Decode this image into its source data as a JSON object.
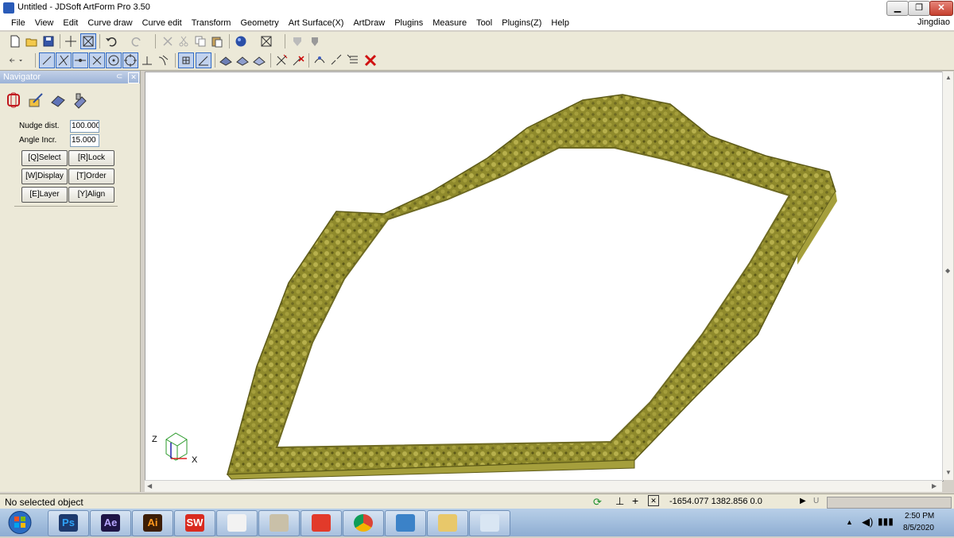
{
  "window": {
    "title": "Untitled - JDSoft ArtForm Pro 3.50",
    "user": "Jingdiao"
  },
  "menu": [
    "File",
    "View",
    "Edit",
    "Curve draw",
    "Curve edit",
    "Transform",
    "Geometry",
    "Art Surface(X)",
    "ArtDraw",
    "Plugins",
    "Measure",
    "Tool",
    "Plugins(Z)",
    "Help"
  ],
  "navigator": {
    "title": "Navigator",
    "nudge_label": "Nudge dist.",
    "nudge_value": "100.000",
    "angle_label": "Angle Incr.",
    "angle_value": "15.000",
    "buttons": [
      "[Q]Select",
      "[R]Lock",
      "[W]Display",
      "[T]Order",
      "[E]Layer",
      "[Y]Align"
    ]
  },
  "axes": {
    "x": "X",
    "z": "Z"
  },
  "status": {
    "message": "No selected object",
    "coords": "-1654.077 1382.856 0.0",
    "u_label": "U"
  },
  "taskbar": {
    "apps": [
      {
        "name": "photoshop",
        "label": "Ps",
        "color": "#1d3a6e",
        "fg": "#2fa3f7"
      },
      {
        "name": "after-effects",
        "label": "Ae",
        "color": "#1e1446",
        "fg": "#b8a6ff"
      },
      {
        "name": "illustrator",
        "label": "Ai",
        "color": "#3d1e05",
        "fg": "#ff9a1f"
      },
      {
        "name": "solidworks",
        "label": "SW",
        "color": "#d92b20",
        "fg": "#ffffff"
      },
      {
        "name": "zbrush",
        "label": "",
        "color": "#f2f2f2",
        "fg": "#000000"
      },
      {
        "name": "artcam",
        "label": "",
        "color": "#c9c0a8",
        "fg": "#000000"
      },
      {
        "name": "sketchup",
        "label": "",
        "color": "#e23a2a",
        "fg": "#ffffff"
      },
      {
        "name": "chrome",
        "label": "",
        "color": "#ffffff",
        "fg": "#000000"
      },
      {
        "name": "app-blue",
        "label": "",
        "color": "#3b82c8",
        "fg": "#ffffff"
      },
      {
        "name": "explorer",
        "label": "",
        "color": "#e8c86a",
        "fg": "#000000"
      },
      {
        "name": "paint",
        "label": "",
        "color": "#d9e6f3",
        "fg": "#000000"
      }
    ],
    "time": "2:50 PM",
    "date": "8/5/2020"
  },
  "colors": {
    "frame": "#8f8a2c",
    "frame_light": "#b7b04c",
    "frame_dark": "#5d5a18"
  }
}
